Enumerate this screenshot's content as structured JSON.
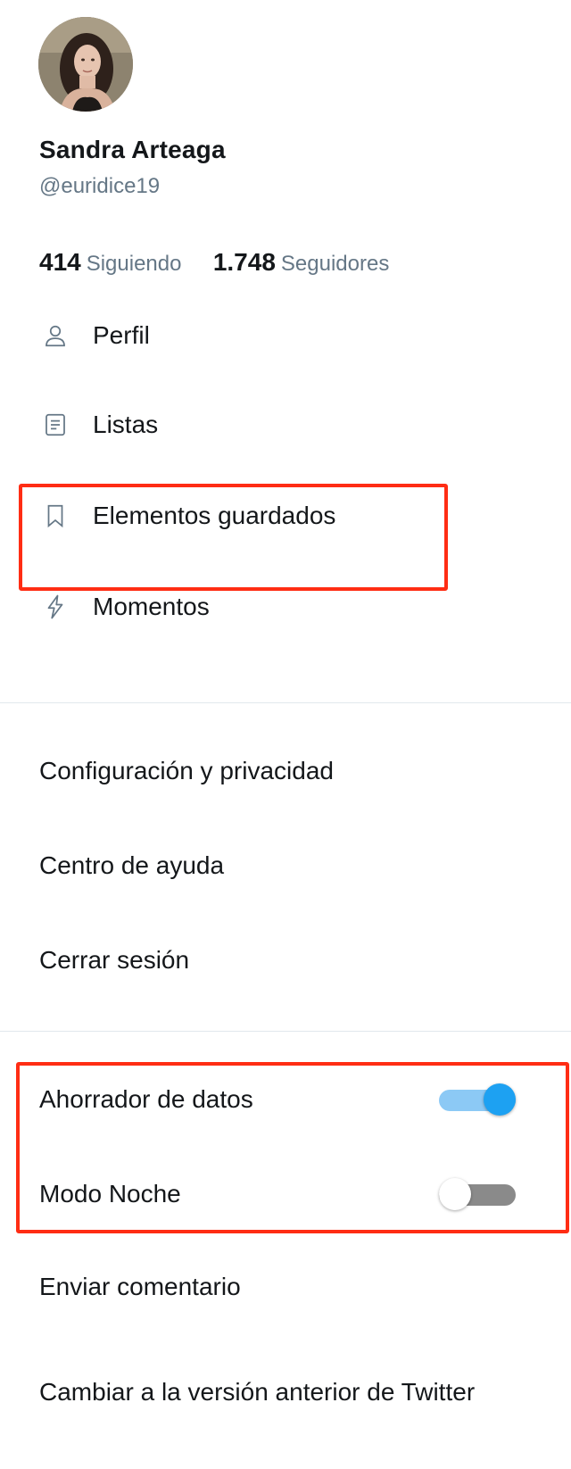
{
  "profile": {
    "name": "Sandra Arteaga",
    "handle": "@euridice19",
    "following_count": "414",
    "following_label": "Siguiendo",
    "followers_count": "1.748",
    "followers_label": "Seguidores"
  },
  "nav": [
    {
      "label": "Perfil",
      "icon": "user-icon"
    },
    {
      "label": "Listas",
      "icon": "list-icon"
    },
    {
      "label": "Elementos guardados",
      "icon": "bookmark-icon"
    },
    {
      "label": "Momentos",
      "icon": "lightning-icon"
    }
  ],
  "menu": {
    "settings": "Configuración y privacidad",
    "help": "Centro de ayuda",
    "logout": "Cerrar sesión"
  },
  "toggles": {
    "data_saver_label": "Ahorrador de datos",
    "data_saver_on": true,
    "night_mode_label": "Modo Noche",
    "night_mode_on": false
  },
  "footer": {
    "feedback": "Enviar comentario",
    "switch_version": "Cambiar a la versión anterior de Twitter"
  },
  "colors": {
    "accent": "#1da1f2",
    "highlight": "#ff2d14",
    "secondary_text": "#657786"
  }
}
